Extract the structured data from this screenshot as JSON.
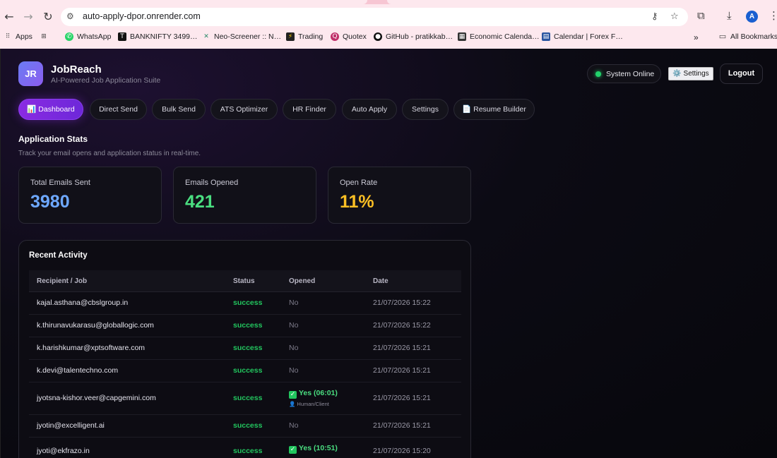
{
  "browser": {
    "url": "auto-apply-dpor.onrender.com",
    "profile_initial": "A",
    "bookmarks": [
      "Apps",
      "WhatsApp",
      "BANKNIFTY 3499…",
      "Neo-Screener :: N…",
      "Trading",
      "Quotex",
      "GitHub - pratikkab…",
      "Economic Calenda…",
      "Calendar | Forex F…"
    ],
    "all_bookmarks": "All Bookmarks"
  },
  "app": {
    "logo": "JR",
    "name": "JobReach",
    "tagline": "AI-Powered Job Application Suite",
    "status": "System Online",
    "settings_button": "⚙️ Settings",
    "logout_button": "Logout"
  },
  "tabs": [
    "📊 Dashboard",
    "Direct Send",
    "Bulk Send",
    "ATS Optimizer",
    "HR Finder",
    "Auto Apply",
    "Settings",
    "📄 Resume Builder"
  ],
  "section": {
    "title": "Application Stats",
    "subtitle": "Track your email opens and application status in real-time."
  },
  "stats": [
    {
      "label": "Total Emails Sent",
      "value": "3980",
      "color": "#6ea8ff"
    },
    {
      "label": "Emails Opened",
      "value": "421",
      "color": "#4ade80"
    },
    {
      "label": "Open Rate",
      "value": "11%",
      "color": "#fbbf24"
    }
  ],
  "activity": {
    "title": "Recent Activity",
    "columns": [
      "Recipient / Job",
      "Status",
      "Opened",
      "Date"
    ],
    "rows": [
      {
        "recipient": "kajal.asthana@cbslgroup.in",
        "status": "success",
        "opened": "No",
        "date": "21/07/2026 15:22"
      },
      {
        "recipient": "k.thirunavukarasu@globallogic.com",
        "status": "success",
        "opened": "No",
        "date": "21/07/2026 15:22"
      },
      {
        "recipient": "k.harishkumar@xptsoftware.com",
        "status": "success",
        "opened": "No",
        "date": "21/07/2026 15:21"
      },
      {
        "recipient": "k.devi@talentechno.com",
        "status": "success",
        "opened": "No",
        "date": "21/07/2026 15:21"
      },
      {
        "recipient": "jyotsna-kishor.veer@capgemini.com",
        "status": "success",
        "opened": "Yes (06:01)",
        "opened_by": "👤 Human/Client",
        "date": "21/07/2026 15:21"
      },
      {
        "recipient": "jyotin@excelligent.ai",
        "status": "success",
        "opened": "No",
        "date": "21/07/2026 15:21"
      },
      {
        "recipient": "jyoti@ekfrazo.in",
        "status": "success",
        "opened": "Yes (10:51)",
        "date": "21/07/2026 15:20"
      }
    ]
  }
}
